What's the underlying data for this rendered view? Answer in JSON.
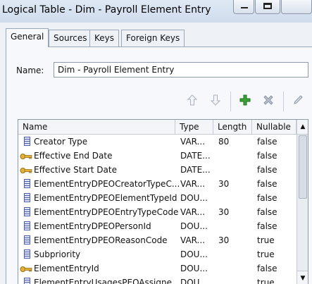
{
  "window": {
    "title": "Logical Table - Dim - Payroll Element Entry"
  },
  "tabs": [
    {
      "label": "General",
      "active": true
    },
    {
      "label": "Sources",
      "active": false
    },
    {
      "label": "Keys",
      "active": false
    },
    {
      "label": "Foreign Keys",
      "active": false
    }
  ],
  "name_field": {
    "label": "Name:",
    "value": "Dim - Payroll Element Entry"
  },
  "toolbar": [
    "up-arrow-icon",
    "down-arrow-icon",
    "add-icon",
    "delete-icon",
    "edit-icon"
  ],
  "grid": {
    "headers": {
      "name": "Name",
      "type": "Type",
      "length": "Length",
      "nullable": "Nullable"
    },
    "rows": [
      {
        "icon": "column-icon",
        "name": "Creator Type",
        "type": "VAR...",
        "length": "80",
        "nullable": "false"
      },
      {
        "icon": "key-icon",
        "name": "Effective End Date",
        "type": "DATE...",
        "length": "",
        "nullable": "false"
      },
      {
        "icon": "key-icon",
        "name": "Effective Start Date",
        "type": "DATE...",
        "length": "",
        "nullable": "false"
      },
      {
        "icon": "column-icon",
        "name": "ElementEntryDPEOCreatorTypeC...",
        "type": "VAR...",
        "length": "30",
        "nullable": "false"
      },
      {
        "icon": "column-icon",
        "name": "ElementEntryDPEOElementTypeId",
        "type": "DOU...",
        "length": "",
        "nullable": "false"
      },
      {
        "icon": "column-icon",
        "name": "ElementEntryDPEOEntryTypeCode",
        "type": "VAR...",
        "length": "30",
        "nullable": "false"
      },
      {
        "icon": "column-icon",
        "name": "ElementEntryDPEOPersonId",
        "type": "DOU...",
        "length": "",
        "nullable": "false"
      },
      {
        "icon": "column-icon",
        "name": "ElementEntryDPEOReasonCode",
        "type": "VAR...",
        "length": "30",
        "nullable": "true"
      },
      {
        "icon": "column-icon",
        "name": "Subpriority",
        "type": "DOU...",
        "length": "",
        "nullable": "true"
      },
      {
        "icon": "key-icon",
        "name": "ElementEntryId",
        "type": "DOU...",
        "length": "",
        "nullable": "false"
      },
      {
        "icon": "column-icon",
        "name": "ElementEntryUsagesPEOAssigne...",
        "type": "DOU...",
        "length": "",
        "nullable": "true"
      }
    ]
  }
}
